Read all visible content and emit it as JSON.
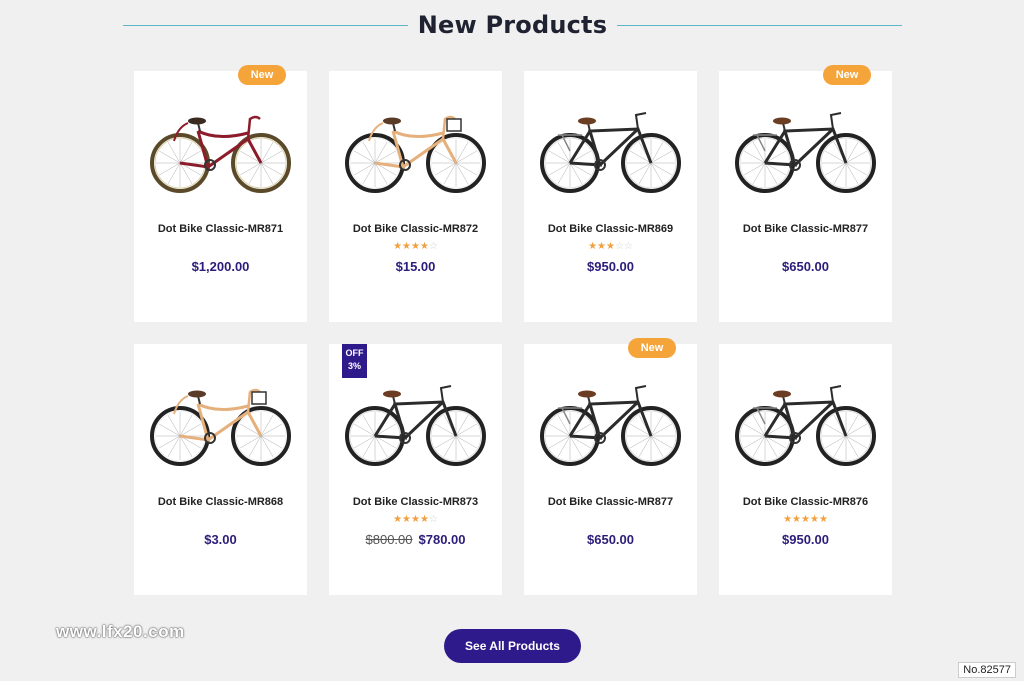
{
  "section_title": "New Products",
  "products": [
    {
      "name": "Dot Bike Classic-MR871",
      "price": "$1,200.00",
      "old_price": "",
      "badge": "New",
      "rating": 0,
      "bike": "cruiser-red"
    },
    {
      "name": "Dot Bike Classic-MR872",
      "price": "$15.00",
      "old_price": "",
      "badge": "",
      "rating": 4,
      "bike": "cruiser-tan"
    },
    {
      "name": "Dot Bike Classic-MR869",
      "price": "$950.00",
      "old_price": "",
      "badge": "",
      "rating": 3,
      "bike": "hybrid-black"
    },
    {
      "name": "Dot Bike Classic-MR877",
      "price": "$650.00",
      "old_price": "",
      "badge": "New",
      "rating": 0,
      "bike": "hybrid-black"
    },
    {
      "name": "Dot Bike Classic-MR868",
      "price": "$3.00",
      "old_price": "",
      "badge": "",
      "rating": 0,
      "bike": "cruiser-tan"
    },
    {
      "name": "Dot Bike Classic-MR873",
      "price": "$780.00",
      "old_price": "$800.00",
      "badge": "OFF 3%",
      "rating": 4,
      "bike": "road-black"
    },
    {
      "name": "Dot Bike Classic-MR877",
      "price": "$650.00",
      "old_price": "",
      "badge": "New",
      "rating": 0,
      "bike": "hybrid-black"
    },
    {
      "name": "Dot Bike Classic-MR876",
      "price": "$950.00",
      "old_price": "",
      "badge": "",
      "rating": 4.5,
      "bike": "hybrid-black"
    }
  ],
  "off_badge": {
    "line1": "OFF",
    "line2": "3%"
  },
  "cta_label": "See All Products",
  "watermark": "www.lfx20.com",
  "tag": "No.82577",
  "colors": {
    "accent": "#2f1a8c",
    "badge_new": "#f5a43a",
    "price": "#2b1d7a",
    "star": "#f2a03d",
    "title_line": "#5fb6c9"
  }
}
